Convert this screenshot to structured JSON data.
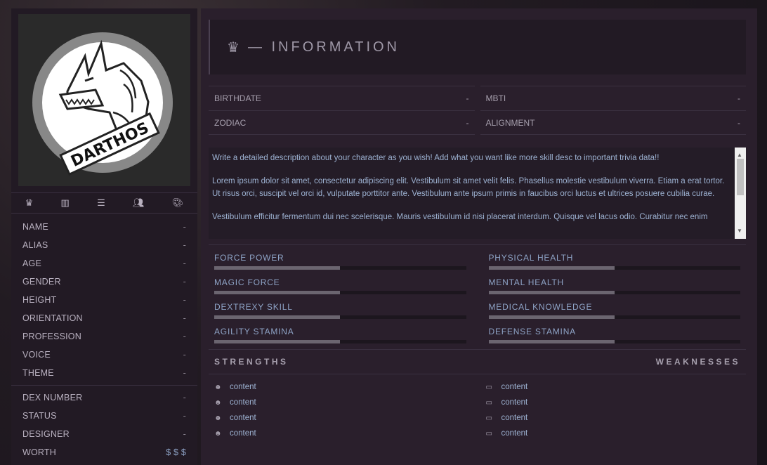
{
  "avatar": {
    "logo_text": "DARTHOS"
  },
  "nav_icons": [
    "crown-icon",
    "chart-icon",
    "list-icon",
    "people-icon",
    "palette-icon"
  ],
  "profile": [
    {
      "label": "NAME",
      "value": "-"
    },
    {
      "label": "ALIAS",
      "value": "-"
    },
    {
      "label": "AGE",
      "value": "-"
    },
    {
      "label": "GENDER",
      "value": "-"
    },
    {
      "label": "HEIGHT",
      "value": "-"
    },
    {
      "label": "ORIENTATION",
      "value": "-"
    },
    {
      "label": "PROFESSION",
      "value": "-"
    },
    {
      "label": "VOICE",
      "value": "-"
    },
    {
      "label": "THEME",
      "value": "-"
    }
  ],
  "details": [
    {
      "label": "DEX NUMBER",
      "value": "-"
    },
    {
      "label": "STATUS",
      "value": "-"
    },
    {
      "label": "DESIGNER",
      "value": "-"
    },
    {
      "label": "WORTH",
      "value": "$ $ $"
    }
  ],
  "header": {
    "title": "— INFORMATION"
  },
  "info": [
    {
      "label": "BIRTHDATE",
      "value": "-"
    },
    {
      "label": "MBTI",
      "value": "-"
    },
    {
      "label": "ZODIAC",
      "value": "-"
    },
    {
      "label": "ALIGNMENT",
      "value": "-"
    }
  ],
  "description": [
    "Write a detailed description about your character as you wish! Add what you want like more skill desc to important trivia data!!",
    "Lorem ipsum dolor sit amet, consectetur adipiscing elit. Vestibulum sit amet velit felis. Phasellus molestie vestibulum viverra. Etiam a erat tortor. Ut risus orci, suscipit vel orci id, vulputate porttitor ante. Vestibulum ante ipsum primis in faucibus orci luctus et ultrices posuere cubilia curae.",
    "Vestibulum efficitur fermentum dui nec scelerisque. Mauris vestibulum id nisi placerat interdum. Quisque vel lacus odio. Curabitur nec enim"
  ],
  "skills": [
    {
      "label": "FORCE POWER",
      "level": 0.5
    },
    {
      "label": "PHYSICAL HEALTH",
      "level": 0.5
    },
    {
      "label": "MAGIC FORCE",
      "level": 0.5
    },
    {
      "label": "MENTAL HEALTH",
      "level": 0.5
    },
    {
      "label": "DEXTREXY SKILL",
      "level": 0.5
    },
    {
      "label": "MEDICAL KNOWLEDGE",
      "level": 0.5
    },
    {
      "label": "AGILITY STAMINA",
      "level": 0.5
    },
    {
      "label": "DEFENSE STAMINA",
      "level": 0.5
    }
  ],
  "strengths": {
    "title": "STRENGTHS",
    "items": [
      "content",
      "content",
      "content",
      "content"
    ]
  },
  "weaknesses": {
    "title": "WEAKNESSES",
    "items": [
      "content",
      "content",
      "content",
      "content"
    ]
  }
}
